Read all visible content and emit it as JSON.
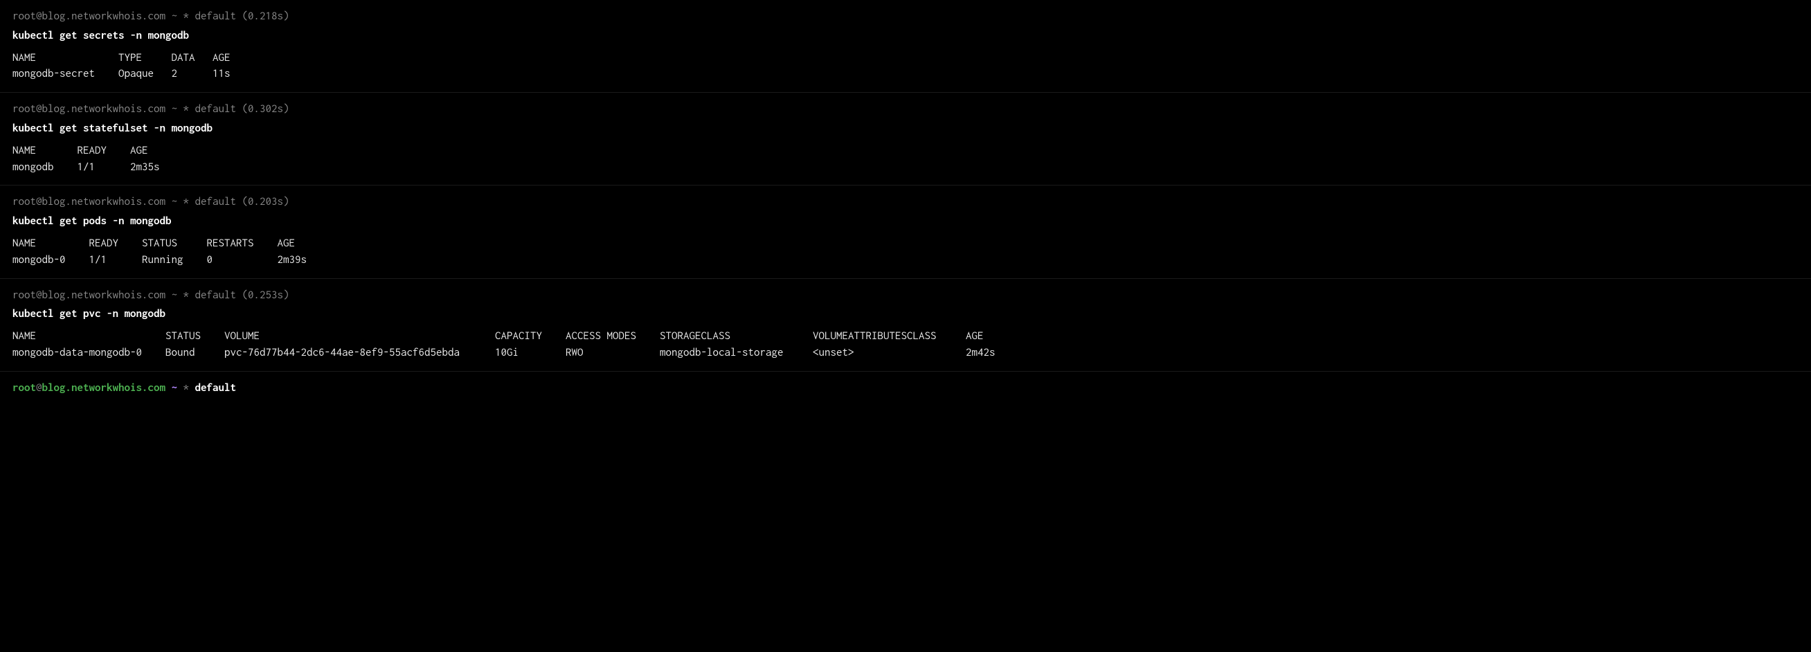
{
  "blocks": [
    {
      "prompt": "root@blog.networkwhois.com ~ * default (0.218s)",
      "command": "kubectl get secrets -n mongodb",
      "output": "NAME              TYPE     DATA   AGE\nmongodb-secret    Opaque   2      11s"
    },
    {
      "prompt": "root@blog.networkwhois.com ~ * default (0.302s)",
      "command": "kubectl get statefulset -n mongodb",
      "output": "NAME       READY    AGE\nmongodb    1/1      2m35s"
    },
    {
      "prompt": "root@blog.networkwhois.com ~ * default (0.203s)",
      "command": "kubectl get pods -n mongodb",
      "output": "NAME         READY    STATUS     RESTARTS    AGE\nmongodb-0    1/1      Running    0           2m39s"
    },
    {
      "prompt": "root@blog.networkwhois.com ~ * default (0.253s)",
      "command": "kubectl get pvc -n mongodb",
      "output": "NAME                      STATUS    VOLUME                                        CAPACITY    ACCESS MODES    STORAGECLASS              VOLUMEATTRIBUTESCLASS     AGE\nmongodb-data-mongodb-0    Bound     pvc-76d77b44-2dc6-44ae-8ef9-55acf6d5ebda      10Gi        RWO             mongodb-local-storage     <unset>                   2m42s"
    }
  ],
  "finalPrompt": {
    "user": "root",
    "at": "@",
    "host": "blog.networkwhois.com",
    "tilde": "~",
    "star": "*",
    "context": "default"
  }
}
